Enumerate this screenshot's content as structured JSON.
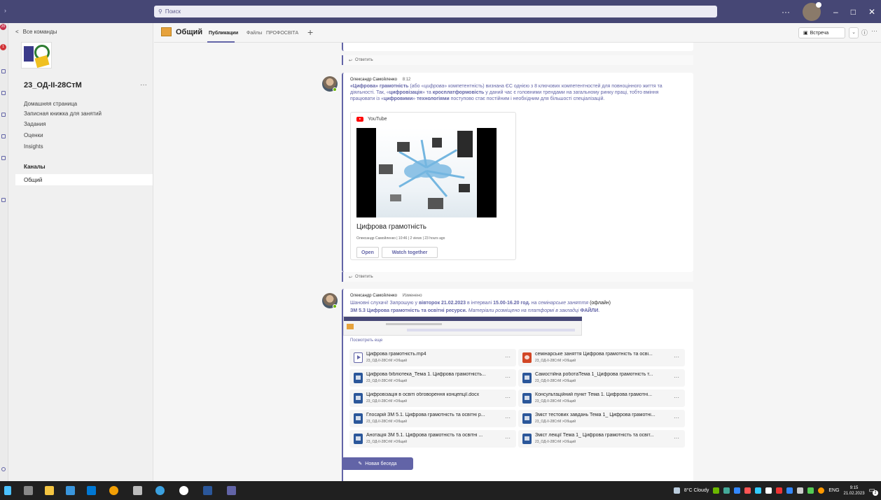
{
  "search": {
    "placeholder": "Поиск"
  },
  "rail": {
    "badge_top": "20",
    "badge_second": "1"
  },
  "sidebar": {
    "back_label": "Все команды",
    "team_name": "23_ОД-ІІ-28СтМ",
    "more": "···",
    "nav": [
      "Домашняя страница",
      "Записная книжка для занятий",
      "Задания",
      "Оценки",
      "Insights"
    ],
    "channels_heading": "Каналы",
    "selected_channel": "Общий"
  },
  "header": {
    "channel_title": "Общий",
    "tabs": [
      "Публикации",
      "Файлы",
      "ПРОФОСВІТА"
    ],
    "add_tab": "+",
    "meet_label": "Встреча",
    "meet_dropdown": "⌄",
    "info": "ⓘ",
    "more": "···"
  },
  "reply_label": "Ответить",
  "post1": {
    "author": "Олександр Самойленко",
    "time": "8:12",
    "text_parts": [
      {
        "t": "«Цифрова» грамотність",
        "s": "st"
      },
      {
        "t": " (або «",
        "s": ""
      },
      {
        "t": "цифрова",
        "s": "it"
      },
      {
        "t": "» компетентність) визнана ЄС однією з 8 ключових компетентностей для повноцінного життя та діяльності. Так, «",
        "s": ""
      },
      {
        "t": "цифровізація",
        "s": "st"
      },
      {
        "t": "» та ",
        "s": ""
      },
      {
        "t": "кросплатформовість",
        "s": "st"
      },
      {
        "t": " у даний час є головними трендами на загальному ринку праці, тобто вміння працювати із «",
        "s": ""
      },
      {
        "t": "цифровими",
        "s": "st"
      },
      {
        "t": "» ",
        "s": ""
      },
      {
        "t": "технологіями",
        "s": "st"
      },
      {
        "t": " поступово стає постійним і необхідним для більшості спеціалізацій.",
        "s": ""
      }
    ],
    "card": {
      "source": "YouTube",
      "title": "Цифрова грамотність",
      "meta": "Олександр Самойленко | 10:46 | 2 views | 23 hours ago",
      "open_label": "Open",
      "watch_label": "Watch together"
    }
  },
  "post2": {
    "author": "Олександр Самойленко",
    "status": "Изменено",
    "line1_parts": [
      {
        "t": "Шановні слухачі! Запрошую у ",
        "s": ""
      },
      {
        "t": "вівторок 21.02.2023",
        "s": "st"
      },
      {
        "t": " в інтервалі ",
        "s": ""
      },
      {
        "t": "15.00-16.20 год.",
        "s": "st"
      },
      {
        "t": " на ",
        "s": ""
      },
      {
        "t": "семінарське заняття",
        "s": "it"
      },
      {
        "t": " (офлайн)",
        "s": "bk"
      }
    ],
    "line2_parts": [
      {
        "t": "ЗМ 5.3 Цифрова грамотність та освітні ресурси.",
        "s": "st"
      },
      {
        "t": " ",
        "s": ""
      },
      {
        "t": "Матеріали розміщено на платформі в закладці ",
        "s": "it"
      },
      {
        "t": "ФАЙЛИ",
        "s": "st"
      },
      {
        "t": ".",
        "s": ""
      }
    ],
    "see_more": "Посмотреть еще",
    "files": [
      {
        "name": "Цифрова грамотність.mp4",
        "path": "23_ОД-ІІ-28СтМ >Общий",
        "type": "mp4"
      },
      {
        "name": "семінарське заняття Цифрова грамотність та осві...",
        "path": "23_ОД-ІІ-28СтМ >Общий",
        "type": "ppt"
      },
      {
        "name": "Цифрова бібліотека_Тема 1. Цифрова грамотність...",
        "path": "23_ОД-ІІ-28СтМ >Общий",
        "type": "doc"
      },
      {
        "name": "Самостійна роботаТема 1_Цифрова грамотність т...",
        "path": "23_ОД-ІІ-28СтМ >Общий",
        "type": "doc"
      },
      {
        "name": "Цифровізація в освіті обговорення концепції.docx",
        "path": "23_ОД-ІІ-28СтМ >Общий",
        "type": "doc"
      },
      {
        "name": "Консультаційний пункт Тема 1. Цифрова грамотні...",
        "path": "23_ОД-ІІ-28СтМ >Общий",
        "type": "doc"
      },
      {
        "name": "Глосарій ЗМ 5.1. Цифрова грамотність та освітні р...",
        "path": "23_ОД-ІІ-28СтМ >Общий",
        "type": "doc"
      },
      {
        "name": "Зміст тестових завдань Тема 1_ Цифрова грамотні...",
        "path": "23_ОД-ІІ-28СтМ >Общий",
        "type": "doc"
      },
      {
        "name": "Анотація ЗМ 5.1. Цифрова грамотність та освітні ...",
        "path": "23_ОД-ІІ-28СтМ >Общий",
        "type": "doc"
      },
      {
        "name": "Зміст лекції Тема 1_ Цифрова грамотність та освіт...",
        "path": "23_ОД-ІІ-28СтМ >Общий",
        "type": "doc"
      }
    ]
  },
  "new_conversation": "Новая беседа",
  "taskbar": {
    "weather": "8°C  Cloudy",
    "lang": "ENG",
    "time": "9:15",
    "date": "21.02.2023",
    "notif_count": "2"
  },
  "colors": {
    "accent": "#6264a7",
    "titlebar": "#464775",
    "taskbar": "#202020"
  }
}
